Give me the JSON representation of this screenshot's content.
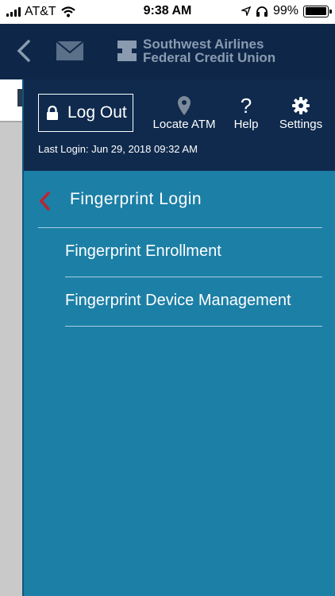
{
  "status_bar": {
    "carrier": "AT&T",
    "time": "9:38 AM",
    "battery": "99%",
    "battery_level": 0.99
  },
  "header": {
    "logo_line1": "Southwest Airlines",
    "logo_line2": "Federal Credit Union"
  },
  "menu": {
    "logout_label": "Log Out",
    "locate_atm_label": "Locate ATM",
    "help_label": "Help",
    "help_glyph": "?",
    "settings_label": "Settings",
    "last_login": "Last Login: Jun 29, 2018 09:32 AM",
    "section_title": "Fingerprint Login",
    "items": [
      {
        "label": "Fingerprint Enrollment"
      },
      {
        "label": "Fingerprint Device Management"
      }
    ]
  },
  "colors": {
    "header_bg": "#0e2749",
    "menu_top_bg": "#0f2a4d",
    "menu_bg": "#1c7fa6",
    "accent_chevron": "#c0212f"
  },
  "icons": {
    "back": "chevron-left-icon",
    "mail": "mail-icon",
    "lock": "lock-icon",
    "location": "location-pin-icon",
    "settings": "gear-icon"
  }
}
